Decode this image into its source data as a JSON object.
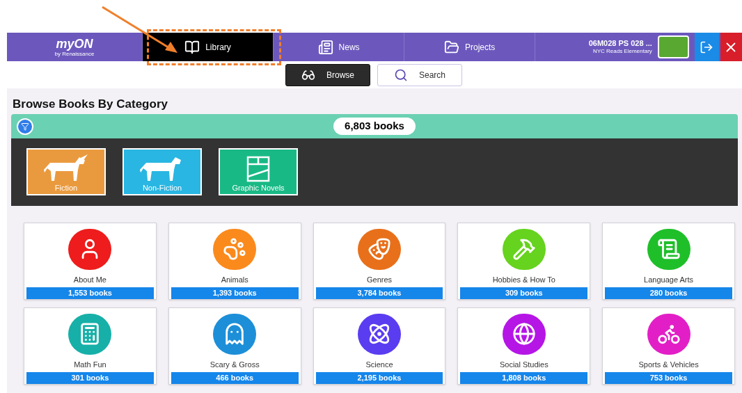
{
  "nav": {
    "logo": {
      "title": "myON",
      "subtitle": "by Renaissance"
    },
    "tabs": [
      {
        "label": "Library",
        "selected": true,
        "kind": "book"
      },
      {
        "label": "News",
        "selected": false,
        "kind": "news"
      },
      {
        "label": "Projects",
        "selected": false,
        "kind": "folder"
      }
    ],
    "user": {
      "name": "06M028 PS 028 ...",
      "school": "NYC Reads Elementary"
    }
  },
  "view_toggle": [
    {
      "label": "Browse",
      "selected": true,
      "kind": "glasses"
    },
    {
      "label": "Search",
      "selected": false,
      "kind": "search"
    }
  ],
  "page_title": "Browse Books By Category",
  "filter_bar": {
    "count": "6,803 books"
  },
  "main_categories": [
    {
      "label": "Fiction",
      "color": "#ea9a3e",
      "kind": "unicorn"
    },
    {
      "label": "Non-Fiction",
      "color": "#29b6e2",
      "kind": "horse"
    },
    {
      "label": "Graphic Novels",
      "color": "#19b985",
      "kind": "panels"
    }
  ],
  "topics": [
    {
      "name": "About Me",
      "count": "1,553 books",
      "color": "#ee1c1c"
    },
    {
      "name": "Animals",
      "count": "1,393 books",
      "color": "#fb8a1c"
    },
    {
      "name": "Genres",
      "count": "3,784 books",
      "color": "#e8701a"
    },
    {
      "name": "Hobbies & How To",
      "count": "309 books",
      "color": "#66d31e"
    },
    {
      "name": "Language Arts",
      "count": "280 books",
      "color": "#1fbf2a"
    },
    {
      "name": "Math Fun",
      "count": "301 books",
      "color": "#17b0a8"
    },
    {
      "name": "Scary & Gross",
      "count": "466 books",
      "color": "#1d8fd8"
    },
    {
      "name": "Science",
      "count": "2,195 books",
      "color": "#5a3df0"
    },
    {
      "name": "Social Studies",
      "count": "1,808 books",
      "color": "#b516e6"
    },
    {
      "name": "Sports & Vehicles",
      "count": "753 books",
      "color": "#e21fc6"
    }
  ]
}
